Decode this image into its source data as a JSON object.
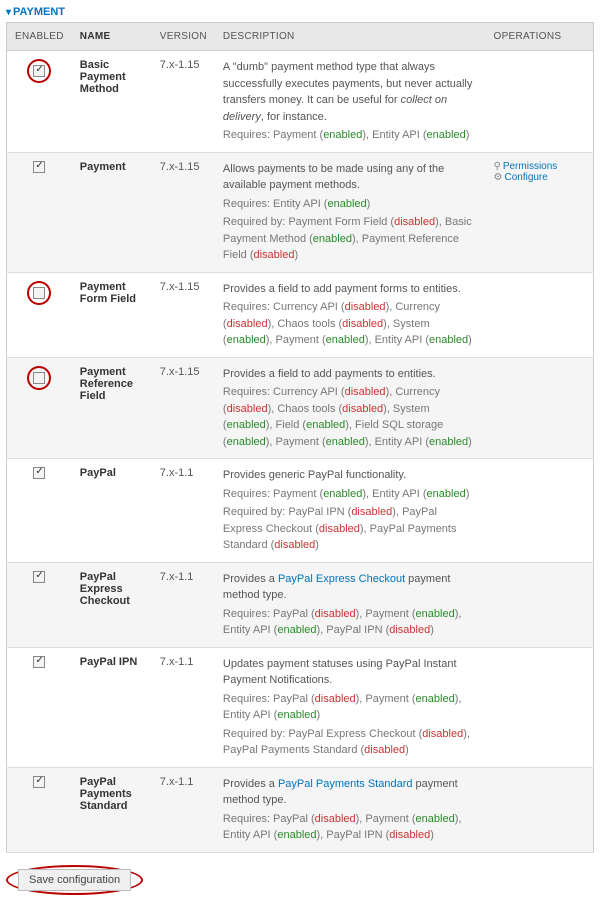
{
  "section_title": "PAYMENT",
  "columns": {
    "enabled": "ENABLED",
    "name": "NAME",
    "version": "VERSION",
    "description": "DESCRIPTION",
    "operations": "OPERATIONS"
  },
  "rows": [
    {
      "enabled": true,
      "circled": true,
      "name": "Basic Payment Method",
      "version": "7.x-1.15",
      "desc": "A \"dumb\" payment method type that always successfully executes payments, but never actually transfers money. It can be useful for <i>collect on delivery</i>, for instance.",
      "req_lines": [
        "Requires: Payment (<span class='enabled'>enabled</span>), Entity API (<span class='enabled'>enabled</span>)"
      ],
      "ops": []
    },
    {
      "enabled": true,
      "circled": false,
      "name": "Payment",
      "version": "7.x-1.15",
      "desc": "Allows payments to be made using any of the available payment methods.",
      "req_lines": [
        "Requires: Entity API (<span class='enabled'>enabled</span>)",
        "Required by: Payment Form Field (<span class='disabled'>disabled</span>), Basic Payment Method (<span class='enabled'>enabled</span>), Payment Reference Field (<span class='disabled'>disabled</span>)"
      ],
      "ops": [
        {
          "label": "Permissions",
          "class": "perm"
        },
        {
          "label": "Configure",
          "class": ""
        }
      ]
    },
    {
      "enabled": false,
      "circled": true,
      "name": "Payment Form Field",
      "version": "7.x-1.15",
      "desc": "Provides a field to add payment forms to entities.",
      "req_lines": [
        "Requires: Currency API (<span class='disabled'>disabled</span>), Currency (<span class='disabled'>disabled</span>), Chaos tools (<span class='disabled'>disabled</span>), System (<span class='enabled'>enabled</span>), Payment (<span class='enabled'>enabled</span>), Entity API (<span class='enabled'>enabled</span>)"
      ],
      "ops": []
    },
    {
      "enabled": false,
      "circled": true,
      "name": "Payment Reference Field",
      "version": "7.x-1.15",
      "desc": "Provides a field to add payments to entities.",
      "req_lines": [
        "Requires: Currency API (<span class='disabled'>disabled</span>), Currency (<span class='disabled'>disabled</span>), Chaos tools (<span class='disabled'>disabled</span>), System (<span class='enabled'>enabled</span>), Field (<span class='enabled'>enabled</span>), Field SQL storage (<span class='enabled'>enabled</span>), Payment (<span class='enabled'>enabled</span>), Entity API (<span class='enabled'>enabled</span>)"
      ],
      "ops": []
    },
    {
      "enabled": true,
      "circled": false,
      "name": "PayPal",
      "version": "7.x-1.1",
      "desc": "Provides generic PayPal functionality.",
      "req_lines": [
        "Requires: Payment (<span class='enabled'>enabled</span>), Entity API (<span class='enabled'>enabled</span>)",
        "Required by: PayPal IPN (<span class='disabled'>disabled</span>), PayPal Express Checkout (<span class='disabled'>disabled</span>), PayPal Payments Standard (<span class='disabled'>disabled</span>)"
      ],
      "ops": []
    },
    {
      "enabled": true,
      "circled": false,
      "name": "PayPal Express Checkout",
      "version": "7.x-1.1",
      "desc": "Provides a <span class='link'>PayPal Express Checkout</span> payment method type.",
      "req_lines": [
        "Requires: PayPal (<span class='disabled'>disabled</span>), Payment (<span class='enabled'>enabled</span>), Entity API (<span class='enabled'>enabled</span>), PayPal IPN (<span class='disabled'>disabled</span>)"
      ],
      "ops": []
    },
    {
      "enabled": true,
      "circled": false,
      "name": "PayPal IPN",
      "version": "7.x-1.1",
      "desc": "Updates payment statuses using PayPal Instant Payment Notifications.",
      "req_lines": [
        "Requires: PayPal (<span class='disabled'>disabled</span>), Payment (<span class='enabled'>enabled</span>), Entity API (<span class='enabled'>enabled</span>)",
        "Required by: PayPal Express Checkout (<span class='disabled'>disabled</span>), PayPal Payments Standard (<span class='disabled'>disabled</span>)"
      ],
      "ops": []
    },
    {
      "enabled": true,
      "circled": false,
      "name": "PayPal Payments Standard",
      "version": "7.x-1.1",
      "desc": "Provides a <span class='link'>PayPal Payments Standard</span> payment method type.",
      "req_lines": [
        "Requires: PayPal (<span class='disabled'>disabled</span>), Payment (<span class='enabled'>enabled</span>), Entity API (<span class='enabled'>enabled</span>), PayPal IPN (<span class='disabled'>disabled</span>)"
      ],
      "ops": []
    }
  ],
  "save_label": "Save configuration"
}
